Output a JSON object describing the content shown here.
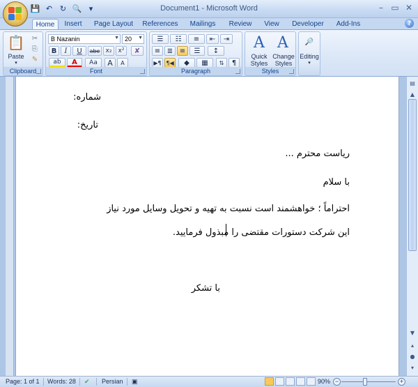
{
  "window": {
    "title": "Document1 - Microsoft Word",
    "minimize_icon": "minimize-icon",
    "maximize_icon": "restore-icon",
    "close_icon": "close-icon"
  },
  "qat": [
    "save-icon",
    "undo-icon",
    "redo-icon",
    "print-preview-icon",
    "customize-icon"
  ],
  "tabs": [
    {
      "label": "Home",
      "active": true
    },
    {
      "label": "Insert"
    },
    {
      "label": "Page Layout"
    },
    {
      "label": "References"
    },
    {
      "label": "Mailings"
    },
    {
      "label": "Review"
    },
    {
      "label": "View"
    },
    {
      "label": "Developer"
    },
    {
      "label": "Add-Ins"
    }
  ],
  "ribbon": {
    "clipboard": {
      "label": "Clipboard",
      "paste": "Paste"
    },
    "font": {
      "label": "Font",
      "name": "B Nazanin",
      "size": "20",
      "bold": "B",
      "italic": "I",
      "underline": "U",
      "strike": "abe",
      "sub": "x₂",
      "sup": "x²",
      "case": "Aa",
      "grow": "A",
      "shrink": "A"
    },
    "paragraph": {
      "label": "Paragraph"
    },
    "styles": {
      "label": "Styles",
      "quick": "Quick",
      "quick2": "Styles",
      "change": "Change",
      "change2": "Styles"
    },
    "editing": {
      "label": "Editing"
    }
  },
  "document": {
    "line1": "شماره:",
    "line2": "تاریخ:",
    "line3": "ریاست محترم ...",
    "line4": "با سلام",
    "line5": "احتراماً ؛ خواهشمند است نسبت به تهیه و تحویل وسایل مورد نیاز",
    "line6": "این شرکت دستورات مقتضی را مبذول فرمایید.",
    "line7": "با تشکر"
  },
  "status": {
    "page": "Page: 1 of 1",
    "words": "Words: 28",
    "language": "Persian",
    "zoom": "90%"
  },
  "colors": {
    "accent": "#15428b",
    "ribbon": "#dbe7f7",
    "highlight": "#f7c95d"
  }
}
